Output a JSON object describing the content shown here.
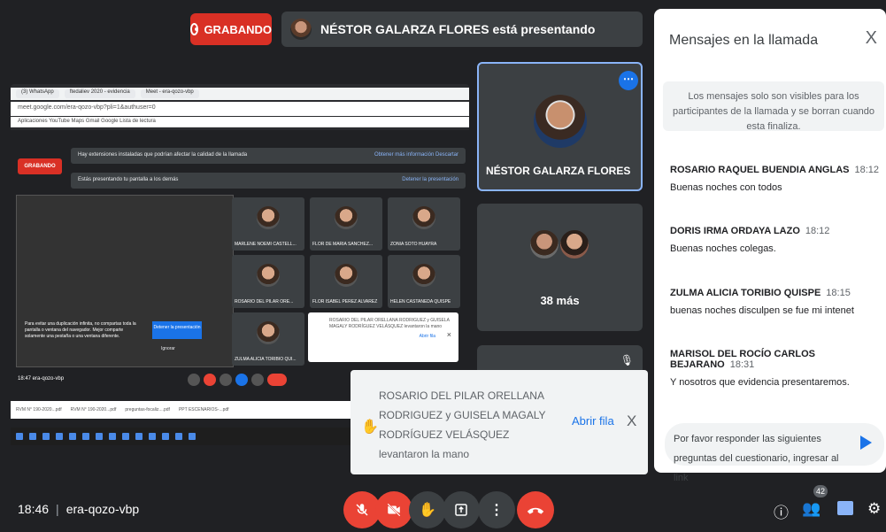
{
  "top": {
    "recording_label": "GRABANDO",
    "presenter_text": "NÉSTOR GALARZA FLORES está presentando"
  },
  "shared_screen": {
    "tabs": [
      "(3) WhatsApp",
      "ftedaliev 2020 - evidencia",
      "Meet - era-qozo-vbp"
    ],
    "url": "meet.google.com/era-qozo-vbp?pli=1&authuser=0",
    "bookmarks": "Aplicaciones  YouTube  Maps  Gmail  Google  Lista de lectura",
    "recording_label": "GRABANDO",
    "banner1": "Hay extensiones instaladas que podrían afectar la calidad de la llamada",
    "banner1_actions": "Obtener más información   Descartar",
    "banner2": "Estás presentando tu pantalla a los demás",
    "banner2_action": "Detener la presentación",
    "tiles": [
      "MARLENE NOEMI CASTELL...",
      "FLOR DE MARIA SANCHEZ...",
      "ZONIA SOTO HUAYRA",
      "ROSARIO DEL PILAR ORE...",
      "FLOR ISABEL PÉREZ ALVAREZ",
      "HELEN CASTAÑEDA QUISPE",
      "ZULMA ALICIA TORIBIO QUI..."
    ],
    "note": "Para evitar una duplicación infinita, no compartas toda la pantalla o ventana del navegador. Mejor comparte solamente una pestaña o una ventana diferente.",
    "stop_btn": "Detener la presentación",
    "ignore": "Ignorar",
    "mini_toast": "ROSARIO DEL PILAR ORELLANA RODRIGUEZ y GUISELA MAGALY RODRÍGUEZ VELÁSQUEZ levantaron la mano",
    "mini_toast_action": "Abrir fila",
    "footer_time": "18:47   era-qozo-vbp",
    "files": [
      "RVM N° 190-2020...pdf",
      "RVM N° 190-2020...pdf",
      "preguntas-focaliz....pdf",
      "PPT ESCENARIOS-...pdf"
    ]
  },
  "tiles": {
    "main_name": "NÉSTOR GALARZA FLORES",
    "more_count": "38 más"
  },
  "toast": {
    "message": "ROSARIO DEL PILAR ORELLANA RODRIGUEZ y GUISELA MAGALY RODRÍGUEZ VELÁSQUEZ levantaron la mano",
    "action": "Abrir fila",
    "close": "X"
  },
  "chat": {
    "title": "Mensajes en la llamada",
    "close": "X",
    "info": "Los mensajes solo son visibles para los participantes de la llamada y se borran cuando esta finaliza.",
    "messages": [
      {
        "sender": "ROSARIO RAQUEL BUENDIA ANGLAS",
        "time": "18:12",
        "text": "Buenas noches con todos"
      },
      {
        "sender": "DORIS IRMA ORDAYA LAZO",
        "time": "18:12",
        "text": "Buenas noches colegas."
      },
      {
        "sender": "ZULMA ALICIA TORIBIO QUISPE",
        "time": "18:15",
        "text": "buenas noches disculpen se fue mi intenet"
      },
      {
        "sender": "MARISOL DEL ROCÍO CARLOS BEJARANO",
        "time": "18:31",
        "text": "Y nosotros que evidencia presentaremos."
      }
    ],
    "input_value": "Por favor responder las siguientes preguntas del cuestionario, ingresar al link"
  },
  "bottom": {
    "time": "18:46",
    "meeting_code": "era-qozo-vbp",
    "people_count": "42"
  },
  "icons": {
    "mic": "mic-off-icon",
    "cam": "camera-off-icon",
    "hand": "raise-hand-icon",
    "present": "present-icon",
    "more": "more-vert-icon",
    "hangup": "hangup-icon"
  },
  "colors": {
    "background": "#202124",
    "tile": "#3c4043",
    "red": "#ea4335",
    "accent": "#1a73e8"
  }
}
